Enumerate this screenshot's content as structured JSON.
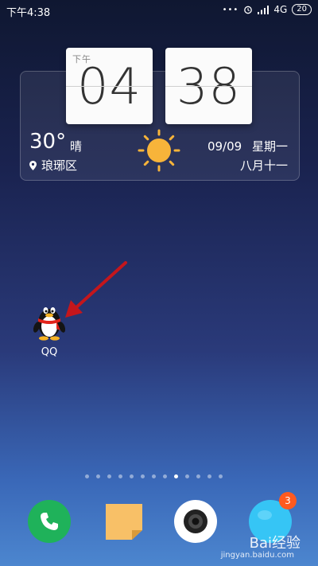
{
  "status_bar": {
    "time": "下午4:38",
    "dots": "•••",
    "network": "4G",
    "battery": "20"
  },
  "clock": {
    "ampm": "下午",
    "hour": "04",
    "minute": "38"
  },
  "weather": {
    "temperature": "30°",
    "condition": "晴",
    "location": "琅琊区",
    "date": "09/09",
    "weekday": "星期一",
    "lunar_date": "八月十一"
  },
  "apps": {
    "qq_label": "QQ"
  },
  "pager": {
    "count": 13,
    "active_index": 8
  },
  "dock": {
    "badge_count": "3"
  },
  "watermark": {
    "logo": "Bai经验",
    "url": "jingyan.baidu.com"
  },
  "colors": {
    "phone": "#1fb25a",
    "notes": "#f8c067",
    "badge": "#ff5a1f",
    "arrow": "#c4161c"
  }
}
